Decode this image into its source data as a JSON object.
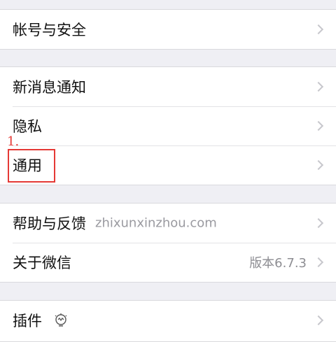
{
  "groups": [
    {
      "rows": [
        {
          "label": "帐号与安全"
        }
      ]
    },
    {
      "rows": [
        {
          "label": "新消息通知"
        },
        {
          "label": "隐私"
        },
        {
          "label": "通用"
        }
      ]
    },
    {
      "rows": [
        {
          "label": "帮助与反馈",
          "watermark": "zhixunxinzhou.com"
        },
        {
          "label": "关于微信",
          "value": "版本6.7.3"
        }
      ]
    },
    {
      "rows": [
        {
          "label": "插件",
          "icon": "plugin-icon"
        }
      ]
    }
  ],
  "annotation": {
    "number": "1.",
    "color": "#e53935"
  },
  "icons": {
    "chevron": "chevron-right-icon",
    "plugin": "plugin-icon"
  },
  "colors": {
    "background": "#efeff4",
    "cell": "#ffffff",
    "separator": "#e2e2e6",
    "chevron": "#c7c7cc",
    "secondary_text": "#8e8e93"
  }
}
